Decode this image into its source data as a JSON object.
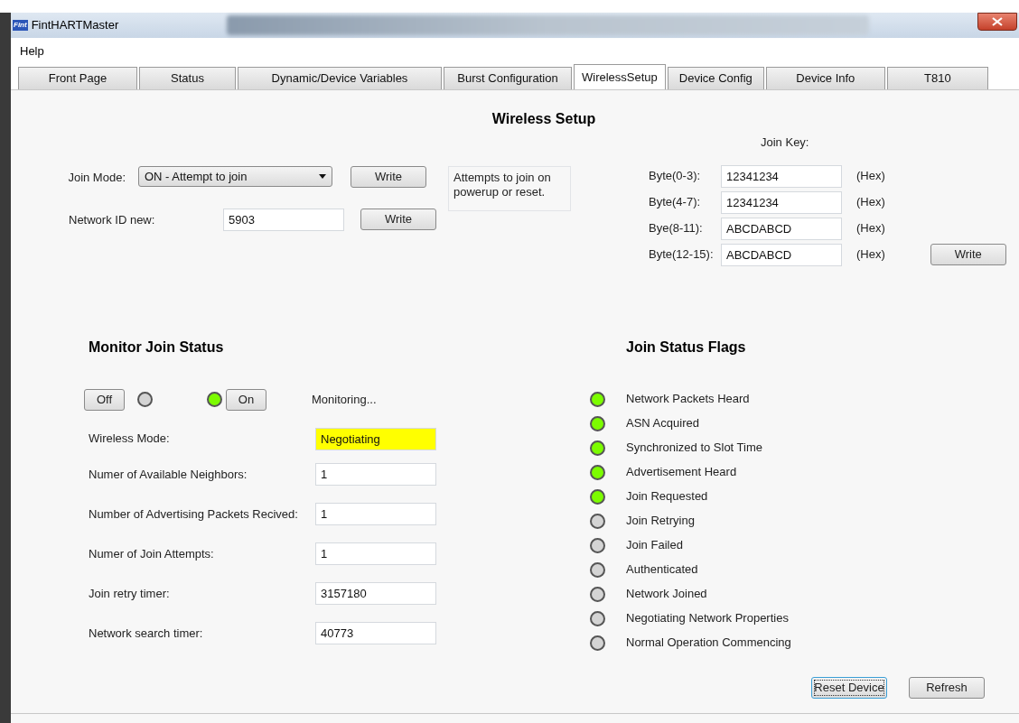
{
  "window": {
    "logo": "Fint",
    "title": "FintHARTMaster"
  },
  "menu": [
    "Help"
  ],
  "tabs": [
    {
      "label": "Front Page",
      "selected": false
    },
    {
      "label": "Status",
      "selected": false
    },
    {
      "label": "Dynamic/Device Variables",
      "selected": false
    },
    {
      "label": "Burst Configuration",
      "selected": false
    },
    {
      "label": "WirelessSetup",
      "selected": true
    },
    {
      "label": "Device Config",
      "selected": false
    },
    {
      "label": "Device Info",
      "selected": false
    },
    {
      "label": "T810",
      "selected": false
    }
  ],
  "wireless_setup": {
    "title": "Wireless Setup",
    "join_mode": {
      "label": "Join Mode:",
      "value": "ON - Attempt to join",
      "button": "Write"
    },
    "network_id": {
      "label": "Network ID new:",
      "value": "5903",
      "button": "Write"
    },
    "help_text": "Attempts to join on powerup or reset.",
    "join_key": {
      "title": "Join Key:",
      "button": "Write",
      "rows": [
        {
          "label": "Byte(0-3):",
          "value": "12341234",
          "unit": "(Hex)"
        },
        {
          "label": "Byte(4-7):",
          "value": "12341234",
          "unit": "(Hex)"
        },
        {
          "label": "Bye(8-11):",
          "value": "ABCDABCD",
          "unit": "(Hex)"
        },
        {
          "label": "Byte(12-15):",
          "value": "ABCDABCD",
          "unit": "(Hex)"
        }
      ]
    }
  },
  "monitor": {
    "title": "Monitor Join Status",
    "off_button": "Off",
    "on_button": "On",
    "on": true,
    "status": "Monitoring...",
    "fields": [
      {
        "label": "Wireless Mode:",
        "value": "Negotiating",
        "highlighted": true
      },
      {
        "label": "Numer of Available Neighbors:",
        "value": "1",
        "highlighted": false
      },
      {
        "label": "Number of Advertising Packets Recived:",
        "value": "1",
        "highlighted": false
      },
      {
        "label": "Numer of Join Attempts:",
        "value": "1",
        "highlighted": false
      },
      {
        "label": "Join retry timer:",
        "value": "3157180",
        "highlighted": false
      },
      {
        "label": "Network search timer:",
        "value": "40773",
        "highlighted": false
      }
    ]
  },
  "flags": {
    "title": "Join Status Flags",
    "items": [
      {
        "label": "Network Packets Heard",
        "on": true
      },
      {
        "label": "ASN Acquired",
        "on": true
      },
      {
        "label": "Synchronized to Slot Time",
        "on": true
      },
      {
        "label": "Advertisement Heard",
        "on": true
      },
      {
        "label": "Join Requested",
        "on": true
      },
      {
        "label": "Join Retrying",
        "on": false
      },
      {
        "label": "Join Failed",
        "on": false
      },
      {
        "label": "Authenticated",
        "on": false
      },
      {
        "label": "Network Joined",
        "on": false
      },
      {
        "label": "Negotiating Network Properties",
        "on": false
      },
      {
        "label": "Normal Operation Commencing",
        "on": false
      }
    ]
  },
  "buttons": [
    {
      "label": "Reset Device",
      "focused": true
    },
    {
      "label": "Refresh",
      "focused": false
    }
  ]
}
